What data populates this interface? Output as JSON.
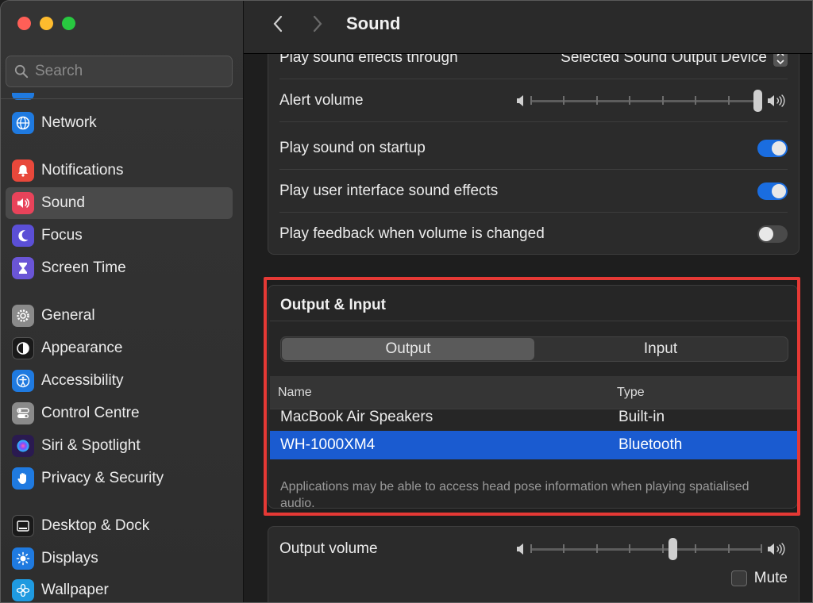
{
  "window": {
    "title": "Sound"
  },
  "sidebar": {
    "search_placeholder": "Search",
    "items": [
      {
        "label": "Network",
        "icon": "globe-icon",
        "color": "#1f7ae0"
      },
      {
        "label": "Notifications",
        "icon": "bell-icon",
        "color": "#e8483b"
      },
      {
        "label": "Sound",
        "icon": "speaker-icon",
        "color": "#e8435a",
        "active": true
      },
      {
        "label": "Focus",
        "icon": "moon-icon",
        "color": "#5b4fd6"
      },
      {
        "label": "Screen Time",
        "icon": "hourglass-icon",
        "color": "#6a55d6"
      },
      {
        "label": "General",
        "icon": "gear-icon",
        "color": "#8a8a8a"
      },
      {
        "label": "Appearance",
        "icon": "appearance-icon",
        "color": "#1a1a1a"
      },
      {
        "label": "Accessibility",
        "icon": "accessibility-icon",
        "color": "#1f7ae0"
      },
      {
        "label": "Control Centre",
        "icon": "switches-icon",
        "color": "#8a8a8a"
      },
      {
        "label": "Siri & Spotlight",
        "icon": "siri-icon",
        "color": "#6a3fd0"
      },
      {
        "label": "Privacy & Security",
        "icon": "hand-icon",
        "color": "#1f7ae0"
      },
      {
        "label": "Desktop & Dock",
        "icon": "dock-icon",
        "color": "#1a1a1a"
      },
      {
        "label": "Displays",
        "icon": "sun-icon",
        "color": "#1f7ae0"
      },
      {
        "label": "Wallpaper",
        "icon": "flower-icon",
        "color": "#1f9ae0"
      }
    ]
  },
  "effects": {
    "play_through_label": "Play sound effects through",
    "play_through_value": "Selected Sound Output Device",
    "alert_volume_label": "Alert volume",
    "alert_volume_level": 1.0,
    "startup_label": "Play sound on startup",
    "startup_on": true,
    "ui_effects_label": "Play user interface sound effects",
    "ui_effects_on": true,
    "feedback_label": "Play feedback when volume is changed",
    "feedback_on": false
  },
  "output_input": {
    "title": "Output & Input",
    "tabs": [
      "Output",
      "Input"
    ],
    "active_tab": "Output",
    "col_name": "Name",
    "col_type": "Type",
    "devices": [
      {
        "name": "MacBook Air Speakers",
        "type": "Built-in",
        "selected": false
      },
      {
        "name": "WH-1000XM4",
        "type": "Bluetooth",
        "selected": true
      }
    ],
    "note": "Applications may be able to access head pose information when playing spatialised audio."
  },
  "output_volume": {
    "label": "Output volume",
    "level": 0.62,
    "mute_label": "Mute",
    "muted": false
  },
  "colors": {
    "accent": "#1a6de0",
    "selection": "#1a5bd0",
    "highlight_box": "#e53935"
  }
}
